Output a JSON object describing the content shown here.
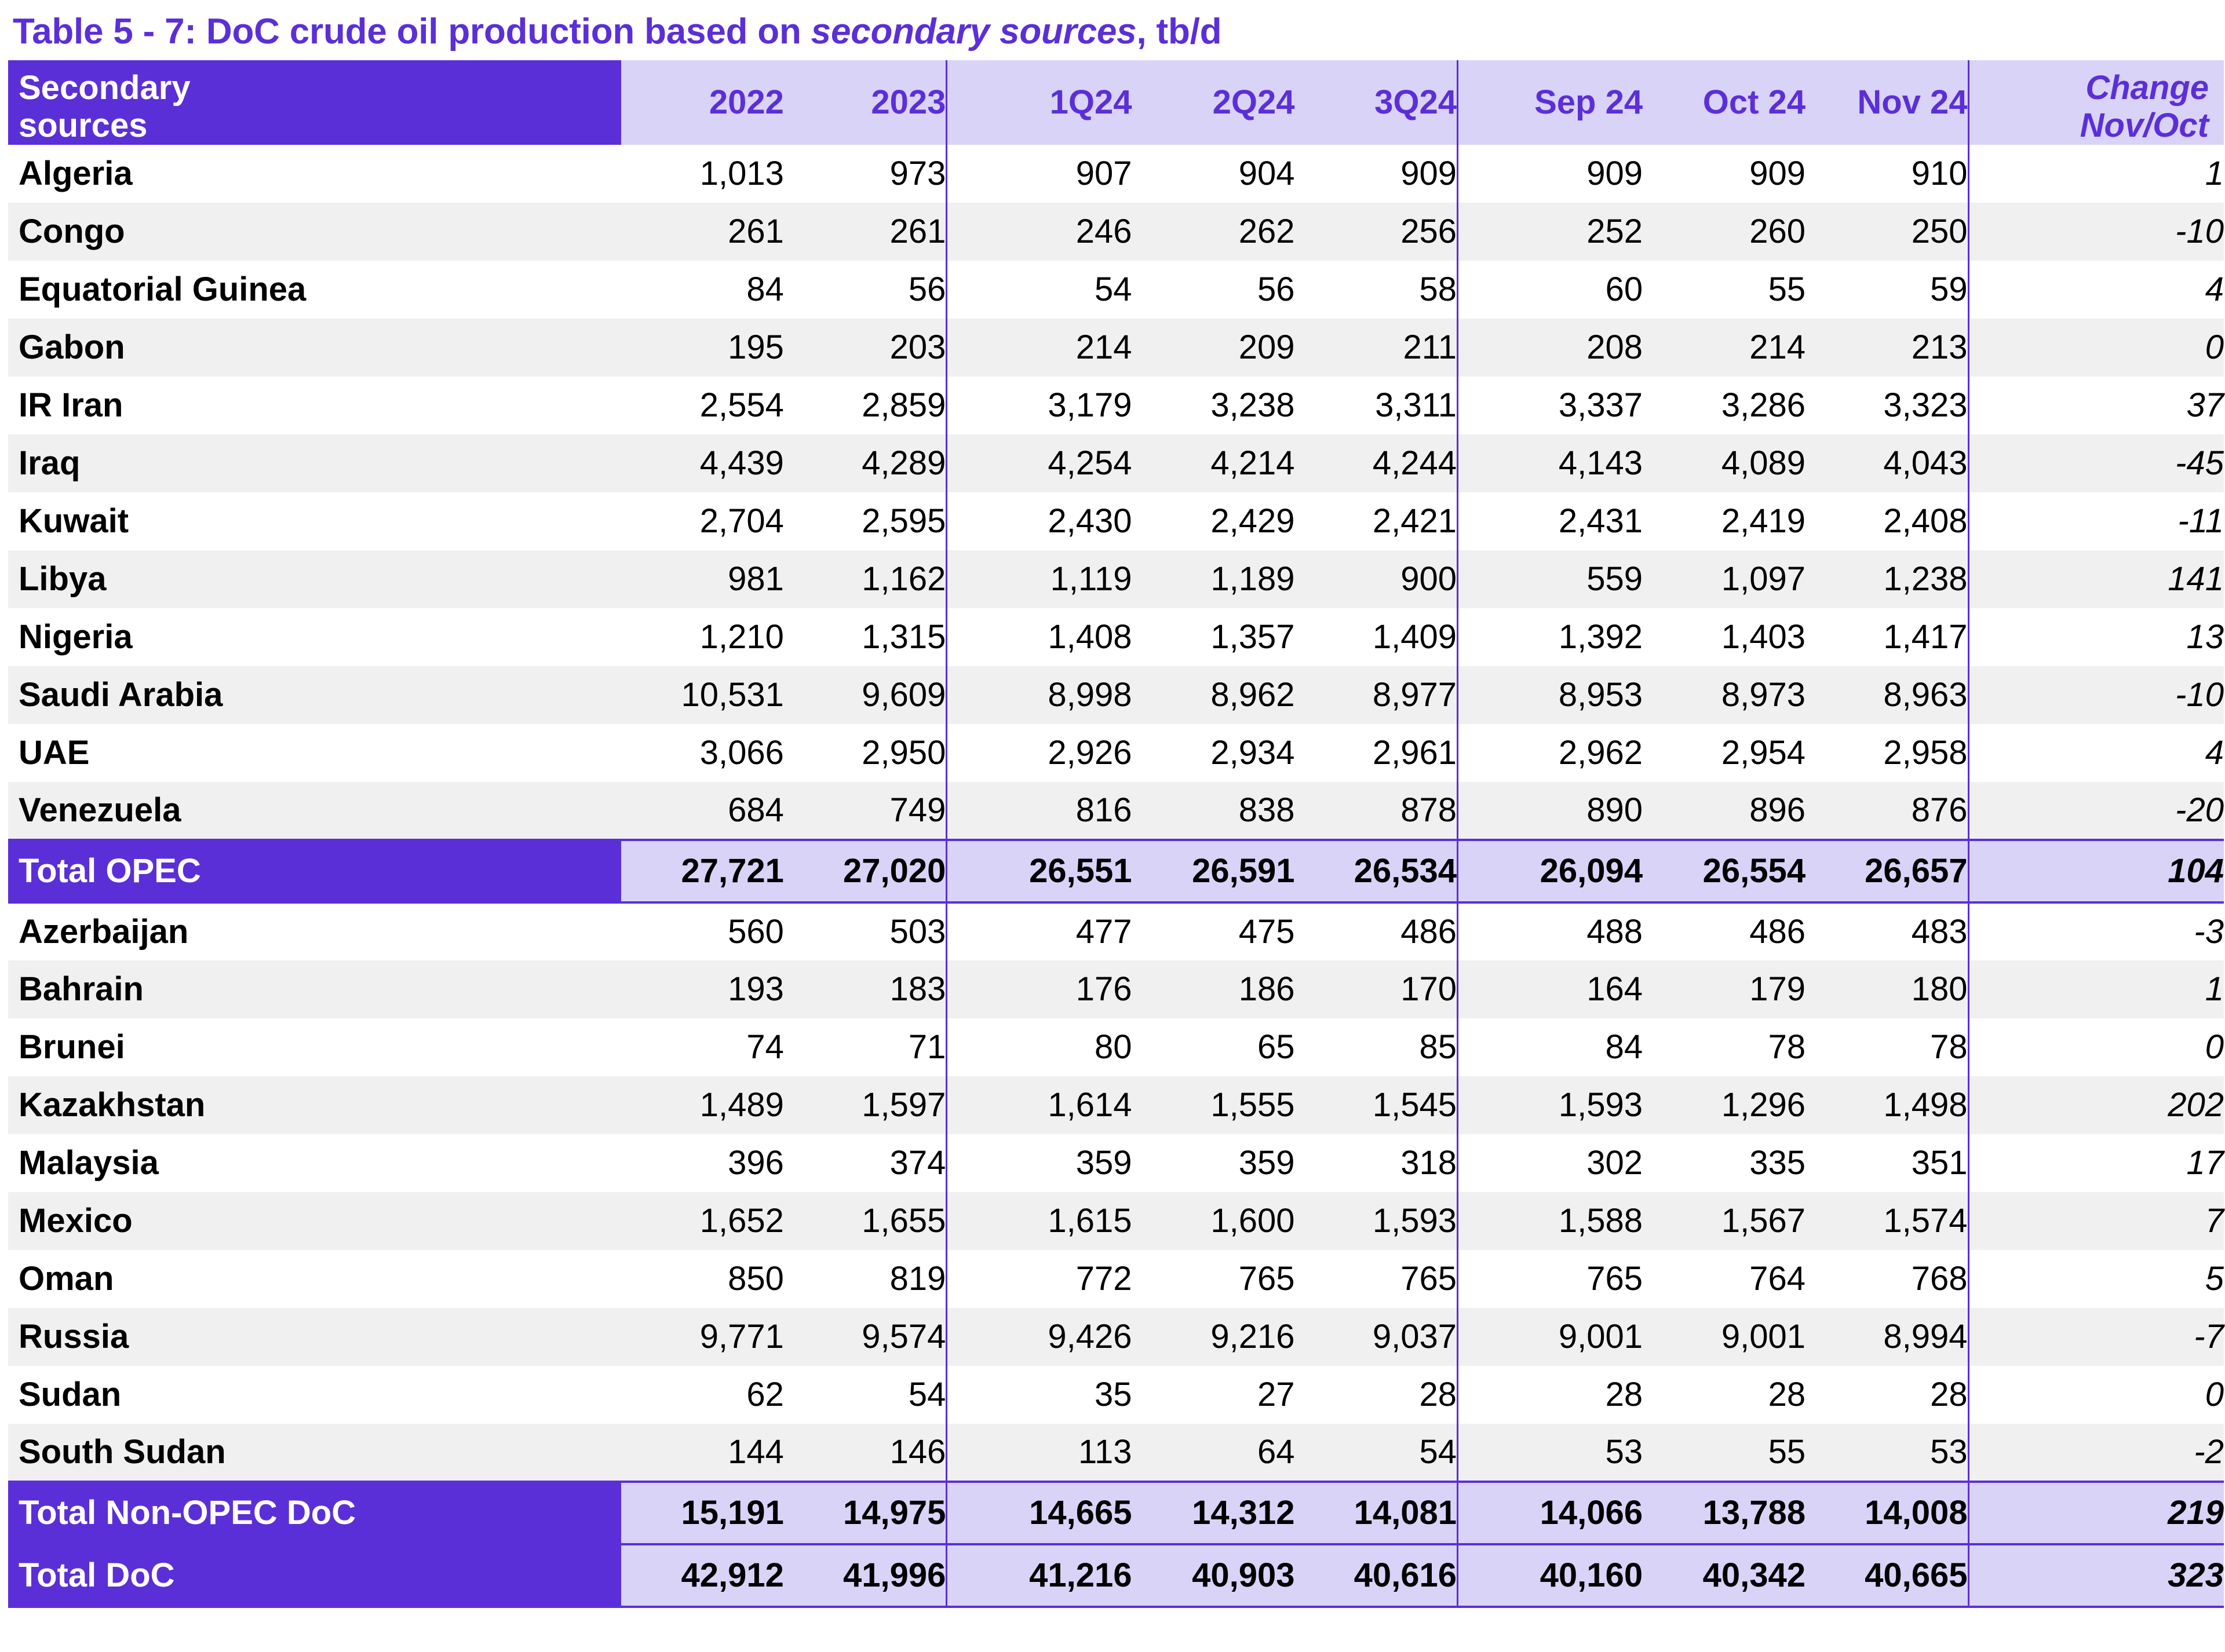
{
  "title": {
    "prefix": "Table 5 - 7: DoC crude oil production based on ",
    "emphasis": "secondary sources",
    "suffix": ", tb/d"
  },
  "colors": {
    "accent": "#5B2FD8",
    "header_fill": "#D9D3F7",
    "alt_row": "#F0F0F0",
    "total_label_fill": "#5B2FD8"
  },
  "table": {
    "columns": [
      {
        "key": "name",
        "label": "Secondary\nsources"
      },
      {
        "key": "y2022",
        "label": "2022"
      },
      {
        "key": "y2023",
        "label": "2023"
      },
      {
        "key": "q1_24",
        "label": "1Q24"
      },
      {
        "key": "q2_24",
        "label": "2Q24"
      },
      {
        "key": "q3_24",
        "label": "3Q24"
      },
      {
        "key": "sep_24",
        "label": "Sep 24"
      },
      {
        "key": "oct_24",
        "label": "Oct 24"
      },
      {
        "key": "nov_24",
        "label": "Nov 24"
      },
      {
        "key": "change",
        "label_top": "Change",
        "label_bottom": "Nov/Oct"
      }
    ],
    "header": {
      "name_line1": "Secondary",
      "name_line2": "sources",
      "y2022": "2022",
      "y2023": "2023",
      "q1_24": "1Q24",
      "q2_24": "2Q24",
      "q3_24": "3Q24",
      "sep_24": "Sep 24",
      "oct_24": "Oct 24",
      "nov_24": "Nov 24",
      "change_top": "Change",
      "change_bottom": "Nov/Oct"
    },
    "opec_rows": [
      {
        "name": "Algeria",
        "y2022": "1,013",
        "y2023": "973",
        "q1_24": "907",
        "q2_24": "904",
        "q3_24": "909",
        "sep_24": "909",
        "oct_24": "909",
        "nov_24": "910",
        "change": "1"
      },
      {
        "name": "Congo",
        "y2022": "261",
        "y2023": "261",
        "q1_24": "246",
        "q2_24": "262",
        "q3_24": "256",
        "sep_24": "252",
        "oct_24": "260",
        "nov_24": "250",
        "change": "-10"
      },
      {
        "name": "Equatorial Guinea",
        "y2022": "84",
        "y2023": "56",
        "q1_24": "54",
        "q2_24": "56",
        "q3_24": "58",
        "sep_24": "60",
        "oct_24": "55",
        "nov_24": "59",
        "change": "4"
      },
      {
        "name": "Gabon",
        "y2022": "195",
        "y2023": "203",
        "q1_24": "214",
        "q2_24": "209",
        "q3_24": "211",
        "sep_24": "208",
        "oct_24": "214",
        "nov_24": "213",
        "change": "0"
      },
      {
        "name": "IR Iran",
        "y2022": "2,554",
        "y2023": "2,859",
        "q1_24": "3,179",
        "q2_24": "3,238",
        "q3_24": "3,311",
        "sep_24": "3,337",
        "oct_24": "3,286",
        "nov_24": "3,323",
        "change": "37"
      },
      {
        "name": "Iraq",
        "y2022": "4,439",
        "y2023": "4,289",
        "q1_24": "4,254",
        "q2_24": "4,214",
        "q3_24": "4,244",
        "sep_24": "4,143",
        "oct_24": "4,089",
        "nov_24": "4,043",
        "change": "-45"
      },
      {
        "name": "Kuwait",
        "y2022": "2,704",
        "y2023": "2,595",
        "q1_24": "2,430",
        "q2_24": "2,429",
        "q3_24": "2,421",
        "sep_24": "2,431",
        "oct_24": "2,419",
        "nov_24": "2,408",
        "change": "-11"
      },
      {
        "name": "Libya",
        "y2022": "981",
        "y2023": "1,162",
        "q1_24": "1,119",
        "q2_24": "1,189",
        "q3_24": "900",
        "sep_24": "559",
        "oct_24": "1,097",
        "nov_24": "1,238",
        "change": "141"
      },
      {
        "name": "Nigeria",
        "y2022": "1,210",
        "y2023": "1,315",
        "q1_24": "1,408",
        "q2_24": "1,357",
        "q3_24": "1,409",
        "sep_24": "1,392",
        "oct_24": "1,403",
        "nov_24": "1,417",
        "change": "13"
      },
      {
        "name": "Saudi Arabia",
        "y2022": "10,531",
        "y2023": "9,609",
        "q1_24": "8,998",
        "q2_24": "8,962",
        "q3_24": "8,977",
        "sep_24": "8,953",
        "oct_24": "8,973",
        "nov_24": "8,963",
        "change": "-10"
      },
      {
        "name": "UAE",
        "y2022": "3,066",
        "y2023": "2,950",
        "q1_24": "2,926",
        "q2_24": "2,934",
        "q3_24": "2,961",
        "sep_24": "2,962",
        "oct_24": "2,954",
        "nov_24": "2,958",
        "change": "4"
      },
      {
        "name": "Venezuela",
        "y2022": "684",
        "y2023": "749",
        "q1_24": "816",
        "q2_24": "838",
        "q3_24": "878",
        "sep_24": "890",
        "oct_24": "896",
        "nov_24": "876",
        "change": "-20"
      }
    ],
    "total_opec": {
      "name": "Total  OPEC",
      "y2022": "27,721",
      "y2023": "27,020",
      "q1_24": "26,551",
      "q2_24": "26,591",
      "q3_24": "26,534",
      "sep_24": "26,094",
      "oct_24": "26,554",
      "nov_24": "26,657",
      "change": "104"
    },
    "non_opec_rows": [
      {
        "name": "Azerbaijan",
        "y2022": "560",
        "y2023": "503",
        "q1_24": "477",
        "q2_24": "475",
        "q3_24": "486",
        "sep_24": "488",
        "oct_24": "486",
        "nov_24": "483",
        "change": "-3"
      },
      {
        "name": "Bahrain",
        "y2022": "193",
        "y2023": "183",
        "q1_24": "176",
        "q2_24": "186",
        "q3_24": "170",
        "sep_24": "164",
        "oct_24": "179",
        "nov_24": "180",
        "change": "1"
      },
      {
        "name": "Brunei",
        "y2022": "74",
        "y2023": "71",
        "q1_24": "80",
        "q2_24": "65",
        "q3_24": "85",
        "sep_24": "84",
        "oct_24": "78",
        "nov_24": "78",
        "change": "0"
      },
      {
        "name": "Kazakhstan",
        "y2022": "1,489",
        "y2023": "1,597",
        "q1_24": "1,614",
        "q2_24": "1,555",
        "q3_24": "1,545",
        "sep_24": "1,593",
        "oct_24": "1,296",
        "nov_24": "1,498",
        "change": "202"
      },
      {
        "name": "Malaysia",
        "y2022": "396",
        "y2023": "374",
        "q1_24": "359",
        "q2_24": "359",
        "q3_24": "318",
        "sep_24": "302",
        "oct_24": "335",
        "nov_24": "351",
        "change": "17"
      },
      {
        "name": "Mexico",
        "y2022": "1,652",
        "y2023": "1,655",
        "q1_24": "1,615",
        "q2_24": "1,600",
        "q3_24": "1,593",
        "sep_24": "1,588",
        "oct_24": "1,567",
        "nov_24": "1,574",
        "change": "7"
      },
      {
        "name": "Oman",
        "y2022": "850",
        "y2023": "819",
        "q1_24": "772",
        "q2_24": "765",
        "q3_24": "765",
        "sep_24": "765",
        "oct_24": "764",
        "nov_24": "768",
        "change": "5"
      },
      {
        "name": "Russia",
        "y2022": "9,771",
        "y2023": "9,574",
        "q1_24": "9,426",
        "q2_24": "9,216",
        "q3_24": "9,037",
        "sep_24": "9,001",
        "oct_24": "9,001",
        "nov_24": "8,994",
        "change": "-7"
      },
      {
        "name": "Sudan",
        "y2022": "62",
        "y2023": "54",
        "q1_24": "35",
        "q2_24": "27",
        "q3_24": "28",
        "sep_24": "28",
        "oct_24": "28",
        "nov_24": "28",
        "change": "0"
      },
      {
        "name": "South Sudan",
        "y2022": "144",
        "y2023": "146",
        "q1_24": "113",
        "q2_24": "64",
        "q3_24": "54",
        "sep_24": "53",
        "oct_24": "55",
        "nov_24": "53",
        "change": "-2"
      }
    ],
    "total_non_opec": {
      "name": "Total Non-OPEC DoC",
      "y2022": "15,191",
      "y2023": "14,975",
      "q1_24": "14,665",
      "q2_24": "14,312",
      "q3_24": "14,081",
      "sep_24": "14,066",
      "oct_24": "13,788",
      "nov_24": "14,008",
      "change": "219"
    },
    "total_doc": {
      "name": "Total DoC",
      "y2022": "42,912",
      "y2023": "41,996",
      "q1_24": "41,216",
      "q2_24": "40,903",
      "q3_24": "40,616",
      "sep_24": "40,160",
      "oct_24": "40,342",
      "nov_24": "40,665",
      "change": "323"
    }
  }
}
